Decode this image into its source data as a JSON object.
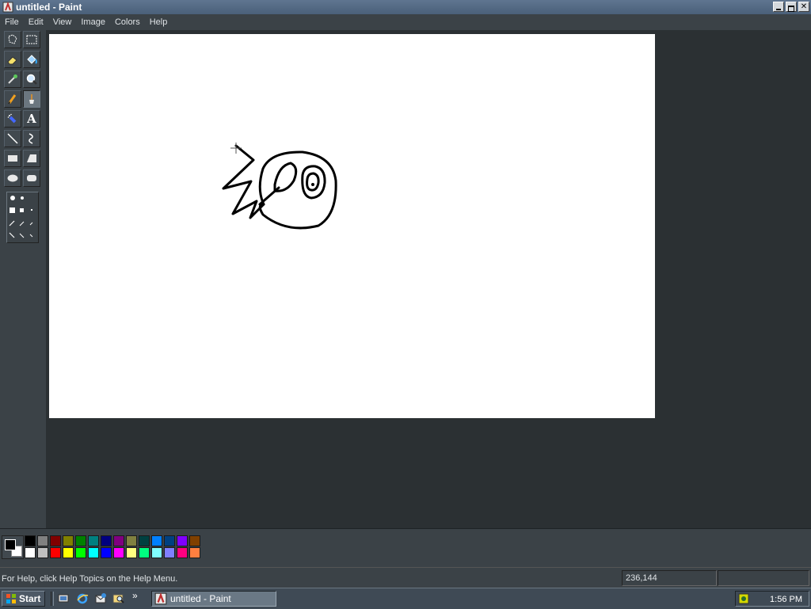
{
  "window": {
    "title": "untitled - Paint"
  },
  "menu": [
    "File",
    "Edit",
    "View",
    "Image",
    "Colors",
    "Help"
  ],
  "toolbox": {
    "tools": [
      {
        "name": "free-form-select",
        "icon": "free-form-select-icon"
      },
      {
        "name": "select",
        "icon": "rect-select-icon"
      },
      {
        "name": "eraser",
        "icon": "eraser-icon"
      },
      {
        "name": "fill",
        "icon": "fill-bucket-icon"
      },
      {
        "name": "pick-color",
        "icon": "eyedropper-icon"
      },
      {
        "name": "magnifier",
        "icon": "magnifier-icon"
      },
      {
        "name": "pencil",
        "icon": "pencil-icon"
      },
      {
        "name": "brush",
        "icon": "brush-icon",
        "active": true
      },
      {
        "name": "airbrush",
        "icon": "airbrush-icon"
      },
      {
        "name": "text",
        "icon": "text-icon",
        "glyph": "A"
      },
      {
        "name": "line",
        "icon": "line-icon"
      },
      {
        "name": "curve",
        "icon": "curve-icon"
      },
      {
        "name": "rectangle",
        "icon": "rectangle-icon"
      },
      {
        "name": "polygon",
        "icon": "polygon-icon"
      },
      {
        "name": "ellipse",
        "icon": "ellipse-icon"
      },
      {
        "name": "rounded-rectangle",
        "icon": "rounded-rect-icon"
      }
    ]
  },
  "colors": {
    "foreground": "#000000",
    "background": "#ffffff",
    "palette_top": [
      "#000000",
      "#808080",
      "#800000",
      "#808000",
      "#008000",
      "#008080",
      "#000080",
      "#800080",
      "#808040",
      "#004040",
      "#0080ff",
      "#004080",
      "#8000ff",
      "#804000"
    ],
    "palette_bottom": [
      "#ffffff",
      "#c0c0c0",
      "#ff0000",
      "#ffff00",
      "#00ff00",
      "#00ffff",
      "#0000ff",
      "#ff00ff",
      "#ffff80",
      "#00ff80",
      "#80ffff",
      "#8080ff",
      "#ff0080",
      "#ff8040"
    ]
  },
  "status": {
    "help_text": "For Help, click Help Topics on the Help Menu.",
    "coordinates": "236,144"
  },
  "taskbar": {
    "start_label": "Start",
    "chevron": "»",
    "task_label": "untitled - Paint",
    "clock": "1:56 PM"
  }
}
